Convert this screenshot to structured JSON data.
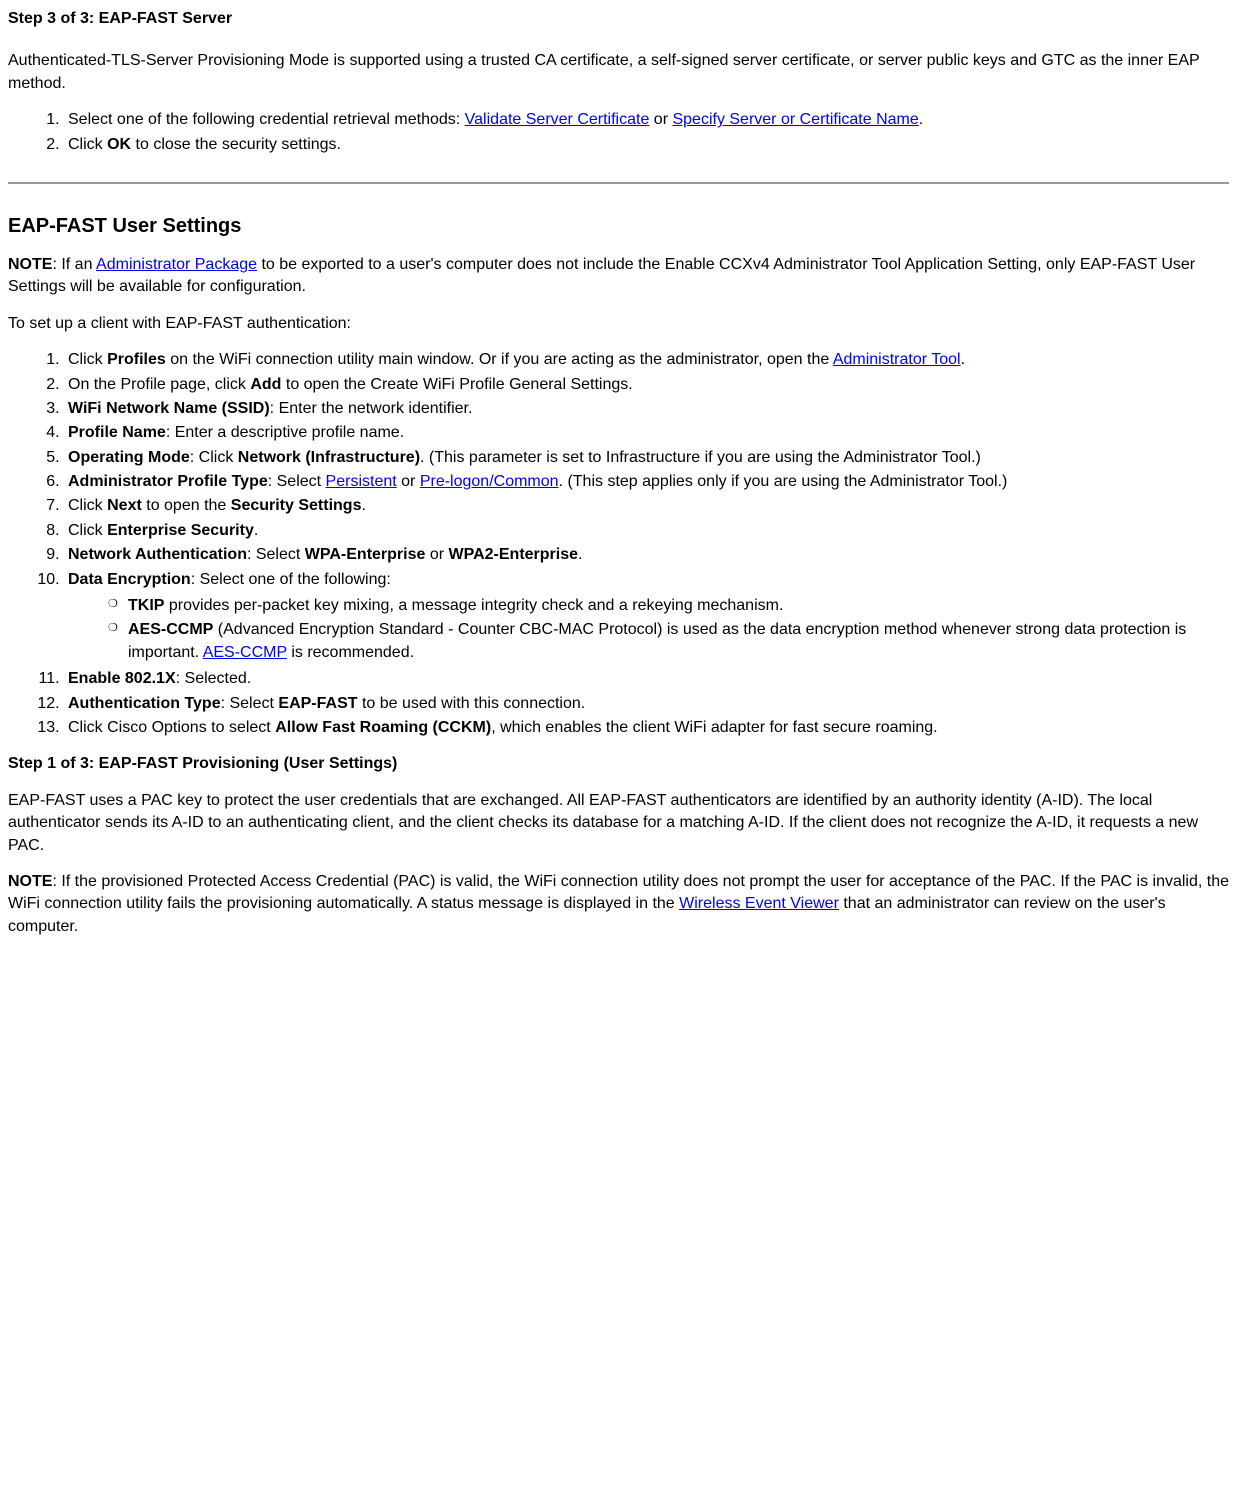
{
  "step3": {
    "title": "Step 3 of 3: EAP-FAST Server",
    "intro": "Authenticated-TLS-Server Provisioning Mode is supported using a trusted CA certificate, a self-signed server certificate, or server public keys and GTC as the inner EAP method.",
    "li1_pre": "Select one of the following credential retrieval methods: ",
    "li1_link1": "Validate Server Certificate",
    "li1_mid": " or ",
    "li1_link2": "Specify Server or Certificate Name",
    "li1_post": ".",
    "li2_pre": "Click ",
    "li2_bold": "OK",
    "li2_post": " to close the security settings."
  },
  "user": {
    "heading": "EAP-FAST User Settings",
    "note_label": "NOTE",
    "note_pre": ": If an ",
    "note_link": "Administrator Package",
    "note_post": " to be exported to a user's computer does not include the Enable CCXv4 Administrator Tool Application Setting, only EAP-FAST User Settings will be available for configuration.",
    "setup_intro": "To set up a client with EAP-FAST authentication:",
    "li1_pre": "Click ",
    "li1_b1": "Profiles",
    "li1_mid": " on the WiFi connection utility main window. Or if you are acting as the administrator, open the ",
    "li1_link": "Administrator Tool",
    "li1_post": ".",
    "li2_pre": "On the Profile page, click ",
    "li2_b": "Add",
    "li2_post": " to open the Create WiFi Profile General Settings.",
    "li3_b": "WiFi Network Name (SSID)",
    "li3_post": ": Enter the network identifier.",
    "li4_b": "Profile Name",
    "li4_post": ": Enter a descriptive profile name.",
    "li5_b1": "Operating Mode",
    "li5_mid": ": Click ",
    "li5_b2": "Network (Infrastructure)",
    "li5_post": ". (This parameter is set to Infrastructure if you are using the Administrator Tool.)",
    "li6_b": "Administrator Profile Type",
    "li6_mid": ": Select ",
    "li6_link1": "Persistent",
    "li6_or": " or ",
    "li6_link2": "Pre-logon/Common",
    "li6_post": ". (This step applies only if you are using the Administrator Tool.)",
    "li7_pre": "Click ",
    "li7_b1": "Next",
    "li7_mid": " to open the ",
    "li7_b2": "Security Settings",
    "li7_post": ".",
    "li8_pre": "Click ",
    "li8_b": "Enterprise Security",
    "li8_post": ".",
    "li9_b1": "Network Authentication",
    "li9_mid": ": Select ",
    "li9_b2": "WPA-Enterprise",
    "li9_or": " or ",
    "li9_b3": "WPA2-Enterprise",
    "li9_post": ".",
    "li10_b": "Data Encryption",
    "li10_post": ": Select one of the following:",
    "li10a_b": "TKIP",
    "li10a_post": " provides per-packet key mixing, a message integrity check and a rekeying mechanism.",
    "li10b_b": "AES-CCMP",
    "li10b_mid": " (Advanced Encryption Standard - Counter CBC-MAC Protocol) is used as the data encryption method whenever strong data protection is important. ",
    "li10b_link": "AES-CCMP",
    "li10b_post": " is recommended.",
    "li11_b": "Enable 802.1X",
    "li11_post": ": Selected.",
    "li12_b1": "Authentication Type",
    "li12_mid": ": Select ",
    "li12_b2": "EAP-FAST",
    "li12_post": " to be used with this connection.",
    "li13_pre": "Click Cisco Options to select ",
    "li13_b": "Allow Fast Roaming (CCKM)",
    "li13_post": ", which enables the client WiFi adapter for fast secure roaming."
  },
  "prov": {
    "title": "Step 1 of 3: EAP-FAST Provisioning (User Settings)",
    "para1": "EAP-FAST uses a PAC key to protect the user credentials that are exchanged. All EAP-FAST authenticators are identified by an authority identity (A-ID). The local authenticator sends its A-ID to an authenticating client, and the client checks its database for a matching A-ID. If the client does not recognize the A-ID, it requests a new PAC.",
    "note_label": "NOTE",
    "note_pre": ": If the provisioned Protected Access Credential (PAC) is valid, the WiFi connection utility does not prompt the user for acceptance of the PAC. If the PAC is invalid, the WiFi connection utility fails the provisioning automatically. A status message is displayed in the ",
    "note_link": "Wireless Event Viewer",
    "note_post": " that an administrator can review on the user's computer."
  }
}
